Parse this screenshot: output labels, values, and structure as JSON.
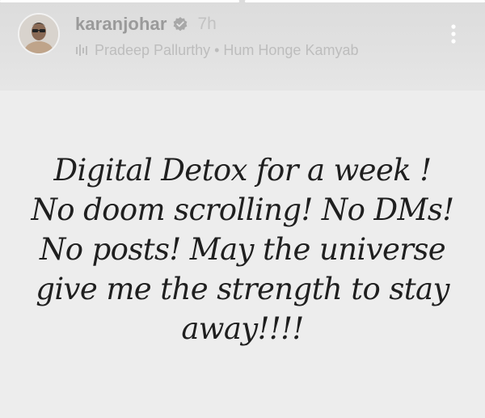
{
  "story": {
    "progress": [
      {
        "state": "complete",
        "fraction": 1.0
      },
      {
        "state": "current",
        "fraction": 1.0
      }
    ]
  },
  "header": {
    "username": "karanjohar",
    "verified": true,
    "time": "7h",
    "music": "Pradeep Pallurthy • Hum Honge Kamyab",
    "icons": {
      "avatar": "profile-photo",
      "verified": "verified-badge-icon",
      "music": "music-bars-icon",
      "more": "more-vertical-icon"
    }
  },
  "caption": {
    "lines": [
      "Digital Detox for a week !",
      "No doom scrolling! No DMs!",
      "No posts! May the universe",
      "give me the strength to stay",
      "away!!!!"
    ]
  },
  "colors": {
    "background": "#ededed",
    "header_band": "#dcdcdc",
    "username": "#9a9a9a",
    "secondary_text": "#bdbdbd",
    "caption_text": "#1f1f1f"
  }
}
